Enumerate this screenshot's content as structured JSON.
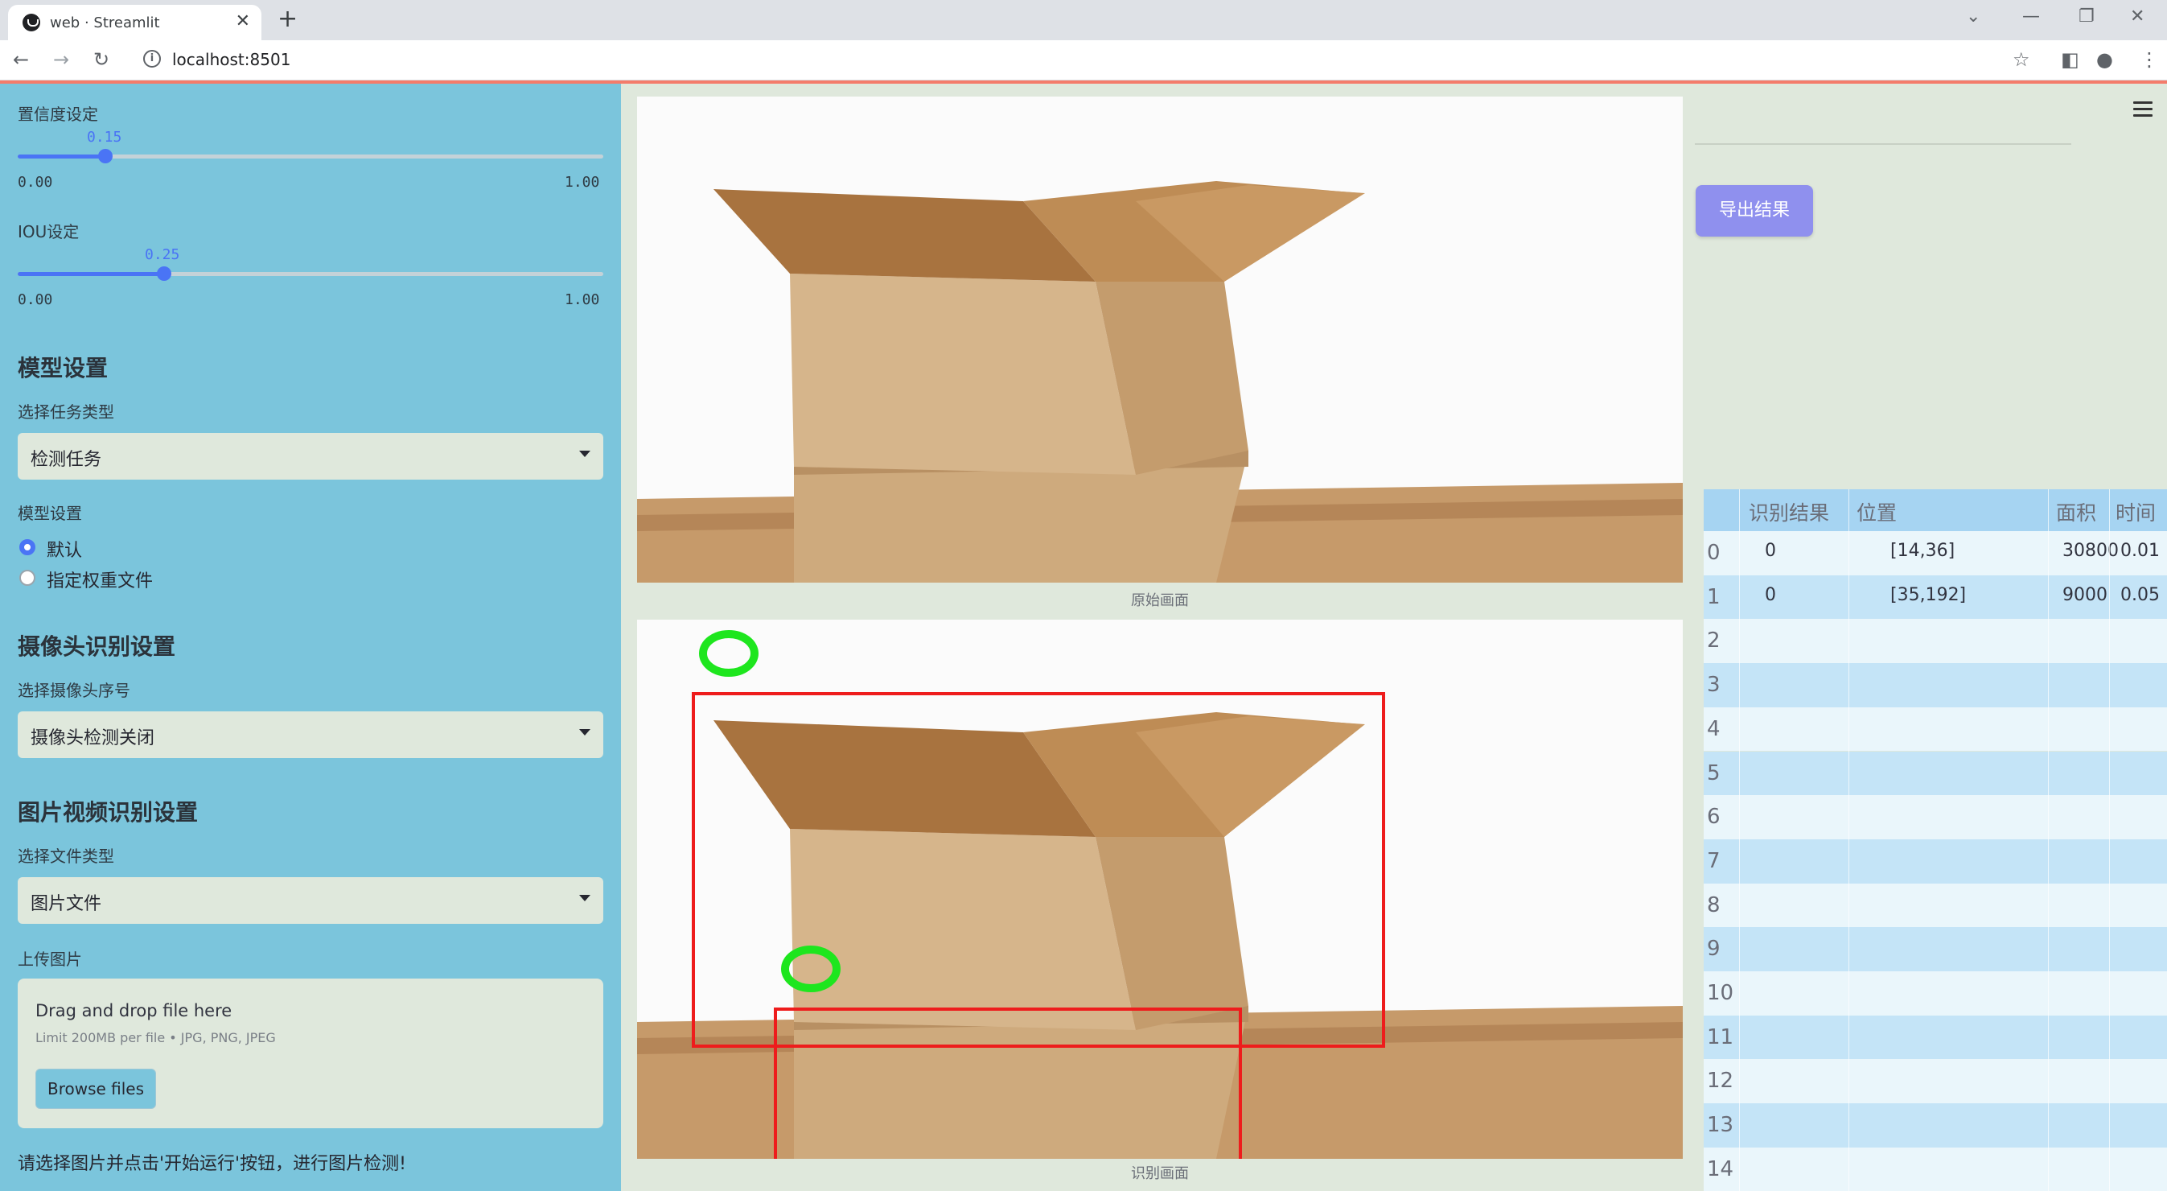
{
  "browser": {
    "tab_title": "web · Streamlit",
    "url": "localhost:8501"
  },
  "sidebar": {
    "confidence": {
      "label": "置信度设定",
      "value": "0.15",
      "min": "0.00",
      "max": "1.00",
      "fraction": 0.15
    },
    "iou": {
      "label": "IOU设定",
      "value": "0.25",
      "min": "0.00",
      "max": "1.00",
      "fraction": 0.25
    },
    "model_heading": "模型设置",
    "task_label": "选择任务类型",
    "task_value": "检测任务",
    "model_label": "模型设置",
    "model_options": [
      "默认",
      "指定权重文件"
    ],
    "model_selected": "默认",
    "camera_heading": "摄像头识别设置",
    "camera_label": "选择摄像头序号",
    "camera_value": "摄像头检测关闭",
    "media_heading": "图片视频识别设置",
    "filetype_label": "选择文件类型",
    "filetype_value": "图片文件",
    "upload_label": "上传图片",
    "upload_title": "Drag and drop file here",
    "upload_limit": "Limit 200MB per file • JPG, PNG, JPEG",
    "browse_label": "Browse files",
    "hint": "请选择图片并点击'开始运行'按钮，进行图片检测!"
  },
  "main": {
    "original_caption": "原始画面",
    "result_caption": "识别画面",
    "export_label": "导出结果"
  },
  "table": {
    "headers": [
      "识别结果",
      "位置",
      "面积",
      "时间"
    ],
    "row_indices": [
      "0",
      "1",
      "2",
      "3",
      "4",
      "5",
      "6",
      "7",
      "8",
      "9",
      "10",
      "11",
      "12",
      "13",
      "14"
    ],
    "rows": [
      {
        "result": "0",
        "position": "[14,36]",
        "area": "30800",
        "time": "0.01"
      },
      {
        "result": "0",
        "position": "[35,192]",
        "area": "9000",
        "time": "0.05"
      }
    ]
  },
  "colors": {
    "sidebar_bg": "#7bc5dc",
    "accent": "#4a74f5",
    "export_button": "#8f90ee",
    "detection_box": "#ee1c1c",
    "detection_marker": "#1ee61e"
  }
}
